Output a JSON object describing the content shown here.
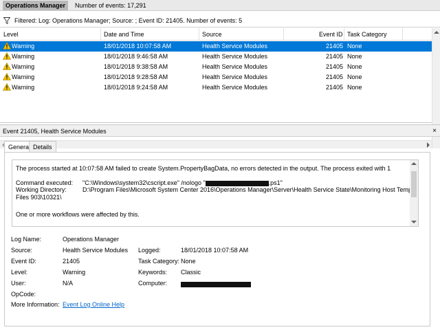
{
  "titlebar": {
    "title": "Operations Manager",
    "events_count": "Number of events: 17,291"
  },
  "filter": {
    "icon": "filter-icon",
    "text": "Filtered: Log: Operations Manager; Source: ; Event ID: 21405. Number of events: 5"
  },
  "grid": {
    "columns": [
      "Level",
      "Date and Time",
      "Source",
      "Event ID",
      "Task Category"
    ],
    "rows": [
      {
        "level": "Warning",
        "datetime": "18/01/2018 10:07:58 AM",
        "source": "Health Service Modules",
        "event_id": "21405",
        "category": "None"
      },
      {
        "level": "Warning",
        "datetime": "18/01/2018 9:46:58 AM",
        "source": "Health Service Modules",
        "event_id": "21405",
        "category": "None"
      },
      {
        "level": "Warning",
        "datetime": "18/01/2018 9:38:58 AM",
        "source": "Health Service Modules",
        "event_id": "21405",
        "category": "None"
      },
      {
        "level": "Warning",
        "datetime": "18/01/2018 9:28:58 AM",
        "source": "Health Service Modules",
        "event_id": "21405",
        "category": "None"
      },
      {
        "level": "Warning",
        "datetime": "18/01/2018 9:24:58 AM",
        "source": "Health Service Modules",
        "event_id": "21405",
        "category": "None"
      }
    ]
  },
  "detail": {
    "title": "Event 21405, Health Service Modules",
    "close": "×",
    "tabs": [
      "General",
      "Details"
    ],
    "message": {
      "line1": "The process started at 10:07:58 AM failed to create System.PropertyBagData, no errors detected in the output.  The process exited with 1",
      "cmd_label": "Command executed:",
      "cmd_prefix": "\"C:\\Windows\\system32\\cscript.exe\" /nologo \"",
      "cmd_suffix": ".ps1\"",
      "wd_label": "Working Directory:",
      "wd_value": "D:\\Program Files\\Microsoft System Center 2016\\Operations Manager\\Server\\Health Service State\\Monitoring Host Temporary",
      "wd_cont": "Files 903\\10321\\",
      "line_last": "One or more workflows were affected by this."
    },
    "props": {
      "log_name_label": "Log Name:",
      "log_name": "Operations Manager",
      "source_label": "Source:",
      "source": "Health Service Modules",
      "logged_label": "Logged:",
      "logged": "18/01/2018 10:07:58 AM",
      "event_id_label": "Event ID:",
      "event_id": "21405",
      "task_label": "Task Category:",
      "task": "None",
      "level_label": "Level:",
      "level": "Warning",
      "keywords_label": "Keywords:",
      "keywords": "Classic",
      "user_label": "User:",
      "user": "N/A",
      "computer_label": "Computer:",
      "opcode_label": "OpCode:",
      "more_label": "More Information:",
      "more_link": "Event Log Online Help"
    }
  },
  "colors": {
    "selection": "#0078d7",
    "link": "#0066cc",
    "warning": "#f2c200"
  }
}
